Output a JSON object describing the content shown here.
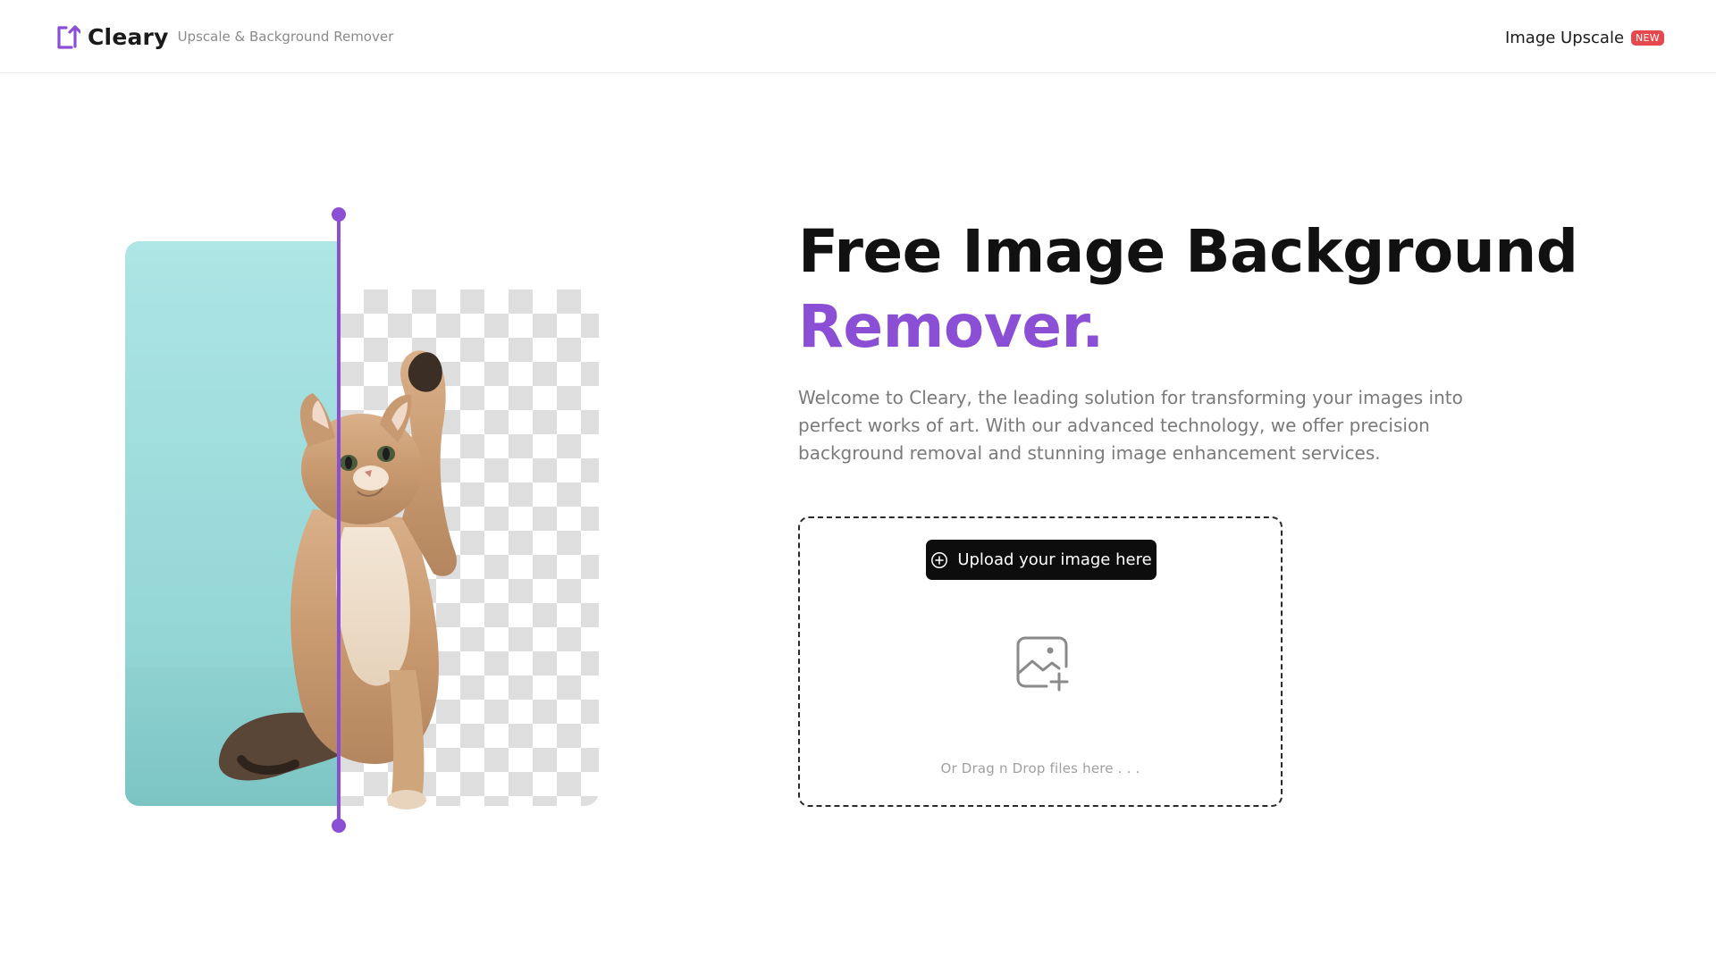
{
  "header": {
    "brand_name": "Cleary",
    "brand_tagline": "Upscale & Background Remover",
    "nav_link_label": "Image Upscale",
    "nav_badge": "NEW"
  },
  "hero": {
    "title_line1": "Free Image Background",
    "title_line2": "Remover.",
    "description": "Welcome to Cleary, the leading solution for transforming your images into perfect works of art. With our advanced technology, we offer precision background removal and stunning image enhancement services."
  },
  "upload": {
    "button_label": "Upload your image here",
    "drop_hint": "Or Drag n Drop files here . . ."
  },
  "icons": {
    "logo": "upload-arrow-logo-icon",
    "button": "plus-circle-icon",
    "dropzone": "image-add-icon"
  },
  "colors": {
    "accent": "#8b4fd6",
    "badge": "#e5484d",
    "button_bg": "#0d0d0d"
  }
}
